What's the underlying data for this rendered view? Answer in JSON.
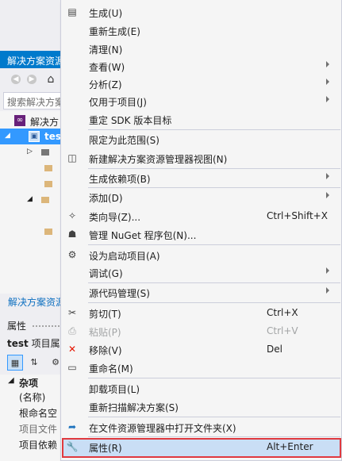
{
  "solution_explorer": {
    "title": "解决方案资源",
    "search_placeholder": "搜索解决方案",
    "tree": {
      "solution_label": "解决方",
      "project_label": "test"
    },
    "footer_link": "解决方案资源"
  },
  "properties_pane": {
    "title": "属性",
    "object_name": "test",
    "object_type": "项目属",
    "category": "杂项",
    "rows": [
      "(名称)",
      "根命名空",
      "项目文件",
      "项目依赖"
    ]
  },
  "context_menu": {
    "items": [
      {
        "label": "生成(U)",
        "icon": "build-icon"
      },
      {
        "label": "重新生成(E)"
      },
      {
        "label": "清理(N)"
      },
      {
        "label": "查看(W)",
        "submenu": true
      },
      {
        "label": "分析(Z)",
        "submenu": true
      },
      {
        "label": "仅用于项目(J)",
        "submenu": true
      },
      {
        "label": "重定 SDK 版本目标"
      },
      {
        "label": "限定为此范围(S)"
      },
      {
        "label": "新建解决方案资源管理器视图(N)",
        "icon": "new-view-icon"
      },
      {
        "label": "生成依赖项(B)",
        "submenu": true
      },
      {
        "label": "添加(D)",
        "submenu": true
      },
      {
        "label": "类向导(Z)...",
        "shortcut": "Ctrl+Shift+X",
        "icon": "class-wizard-icon"
      },
      {
        "label": "管理 NuGet 程序包(N)...",
        "icon": "nuget-icon"
      },
      {
        "label": "设为启动项目(A)",
        "icon": "gear-icon"
      },
      {
        "label": "调试(G)",
        "submenu": true
      },
      {
        "label": "源代码管理(S)",
        "submenu": true
      },
      {
        "label": "剪切(T)",
        "shortcut": "Ctrl+X",
        "icon": "scissors-icon"
      },
      {
        "label": "粘贴(P)",
        "shortcut": "Ctrl+V",
        "icon": "paste-icon",
        "disabled": true
      },
      {
        "label": "移除(V)",
        "shortcut": "Del",
        "icon": "remove-icon"
      },
      {
        "label": "重命名(M)",
        "icon": "rename-icon"
      },
      {
        "label": "卸载项目(L)"
      },
      {
        "label": "重新扫描解决方案(S)"
      },
      {
        "label": "在文件资源管理器中打开文件夹(X)",
        "icon": "open-folder-icon"
      },
      {
        "label": "属性(R)",
        "shortcut": "Alt+Enter",
        "icon": "wrench-icon",
        "highlighted": true
      }
    ]
  },
  "colors": {
    "accent": "#007acc",
    "selection": "#3399ff",
    "highlight_border": "#e0393e",
    "highlight_fill": "#c9def5"
  }
}
